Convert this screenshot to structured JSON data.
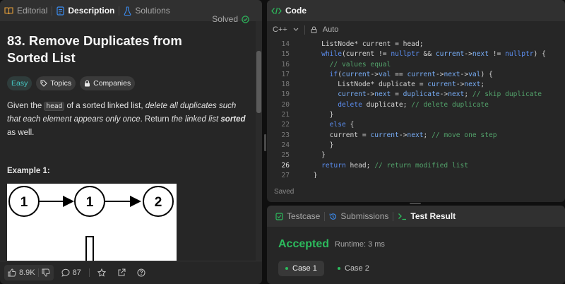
{
  "left_tabs": [
    {
      "label": "Editorial",
      "icon": "book-icon"
    },
    {
      "label": "Description",
      "icon": "document-icon"
    },
    {
      "label": "Solutions",
      "icon": "flask-icon"
    }
  ],
  "problem": {
    "title": "83. Remove Duplicates from Sorted List",
    "status": "Solved",
    "difficulty": "Easy",
    "topics_label": "Topics",
    "companies_label": "Companies",
    "desc": {
      "p1": "Given the ",
      "code": "head",
      "p2": " of a sorted linked list, ",
      "p3": "delete all duplicates such that each element appears only once",
      "p4": ". Return ",
      "p5": "the linked list ",
      "p6": "sorted",
      "p7": " as well."
    },
    "example_title": "Example 1:",
    "example_nodes": [
      "1",
      "1",
      "2"
    ]
  },
  "actions": {
    "likes": "8.9K",
    "comments": "87"
  },
  "code_panel": {
    "title": "Code",
    "language": "C++",
    "mode": "Auto",
    "saved_label": "Saved",
    "lines": [
      {
        "n": "14",
        "indent": 4,
        "parts": [
          [
            "t",
            "ListNode* current = head;"
          ]
        ]
      },
      {
        "n": "15",
        "indent": 4,
        "parts": [
          [
            "kw",
            "while"
          ],
          [
            "t",
            "("
          ],
          [
            "t",
            "current != "
          ],
          [
            "kw",
            "nullptr"
          ],
          [
            "t",
            " && "
          ],
          [
            "vr",
            "current"
          ],
          [
            "t",
            "->"
          ],
          [
            "vr",
            "next"
          ],
          [
            "t",
            " != "
          ],
          [
            "kw",
            "nullptr"
          ],
          [
            "t",
            ") {"
          ]
        ]
      },
      {
        "n": "16",
        "indent": 6,
        "parts": [
          [
            "cm",
            "// values equal"
          ]
        ]
      },
      {
        "n": "17",
        "indent": 6,
        "parts": [
          [
            "kw",
            "if"
          ],
          [
            "t",
            "("
          ],
          [
            "vr",
            "current"
          ],
          [
            "t",
            "->"
          ],
          [
            "vr",
            "val"
          ],
          [
            "t",
            " == "
          ],
          [
            "vr",
            "current"
          ],
          [
            "t",
            "->"
          ],
          [
            "vr",
            "next"
          ],
          [
            "t",
            "->"
          ],
          [
            "vr",
            "val"
          ],
          [
            "t",
            ") {"
          ]
        ]
      },
      {
        "n": "18",
        "indent": 8,
        "parts": [
          [
            "t",
            "ListNode* duplicate = "
          ],
          [
            "vr",
            "current"
          ],
          [
            "t",
            "->"
          ],
          [
            "vr",
            "next"
          ],
          [
            "t",
            ";"
          ]
        ]
      },
      {
        "n": "19",
        "indent": 8,
        "parts": [
          [
            "vr",
            "current"
          ],
          [
            "t",
            "->"
          ],
          [
            "vr",
            "next"
          ],
          [
            "t",
            " = "
          ],
          [
            "vr",
            "duplicate"
          ],
          [
            "t",
            "->"
          ],
          [
            "vr",
            "next"
          ],
          [
            "t",
            "; "
          ],
          [
            "cm",
            "// skip duplicate"
          ]
        ]
      },
      {
        "n": "20",
        "indent": 8,
        "parts": [
          [
            "kw",
            "delete"
          ],
          [
            "t",
            " duplicate; "
          ],
          [
            "cm",
            "// delete duplicate"
          ]
        ]
      },
      {
        "n": "21",
        "indent": 6,
        "parts": [
          [
            "t",
            "}"
          ]
        ]
      },
      {
        "n": "22",
        "indent": 6,
        "parts": [
          [
            "kw",
            "else"
          ],
          [
            "t",
            " {"
          ]
        ]
      },
      {
        "n": "23",
        "indent": 6,
        "parts": [
          [
            "t",
            "current = "
          ],
          [
            "vr",
            "current"
          ],
          [
            "t",
            "->"
          ],
          [
            "vr",
            "next"
          ],
          [
            "t",
            "; "
          ],
          [
            "cm",
            "// move one step"
          ]
        ]
      },
      {
        "n": "24",
        "indent": 6,
        "parts": [
          [
            "t",
            "}"
          ]
        ]
      },
      {
        "n": "25",
        "indent": 4,
        "parts": [
          [
            "t",
            "}"
          ]
        ]
      },
      {
        "n": "26",
        "indent": 4,
        "parts": [
          [
            "kw",
            "return"
          ],
          [
            "t",
            " head; "
          ],
          [
            "cm",
            "// return modified "
          ],
          [
            "cm",
            "list"
          ]
        ]
      },
      {
        "n": "27",
        "indent": 2,
        "parts": [
          [
            "t",
            "}"
          ]
        ]
      }
    ],
    "current_line": "26"
  },
  "result_panel": {
    "tabs": [
      {
        "label": "Testcase",
        "icon": "checkbox-icon"
      },
      {
        "label": "Submissions",
        "icon": "history-icon"
      },
      {
        "label": "Test Result",
        "icon": "terminal-icon"
      }
    ],
    "verdict": "Accepted",
    "runtime": "Runtime: 3 ms",
    "cases": [
      "Case 1",
      "Case 2"
    ]
  },
  "colors": {
    "accepted": "#2cbb5d",
    "easy": "#46c6c2",
    "code_icon": "#2cbb5d"
  }
}
